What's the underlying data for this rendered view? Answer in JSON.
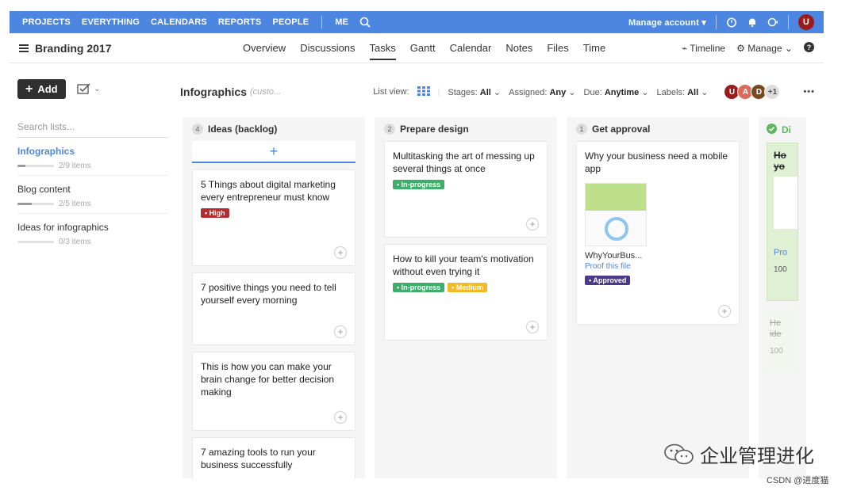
{
  "topnav": {
    "items": [
      "PROJECTS",
      "EVERYTHING",
      "CALENDARS",
      "REPORTS",
      "PEOPLE"
    ],
    "me": "ME",
    "manage_account": "Manage account",
    "user_initial": "U"
  },
  "project": {
    "title": "Branding 2017",
    "tabs": [
      "Overview",
      "Discussions",
      "Tasks",
      "Gantt",
      "Calendar",
      "Notes",
      "Files",
      "Time"
    ],
    "active_tab": "Tasks",
    "timeline": "Timeline",
    "manage": "Manage"
  },
  "sidebar": {
    "add_label": "Add",
    "search_placeholder": "Search lists...",
    "lists": [
      {
        "name": "Infographics",
        "progress": "2/9 items",
        "fraction": 0.22,
        "active": true
      },
      {
        "name": "Blog content",
        "progress": "2/5 items",
        "fraction": 0.4,
        "active": false
      },
      {
        "name": "Ideas for infographics",
        "progress": "0/3 items",
        "fraction": 0,
        "active": false
      }
    ]
  },
  "board": {
    "title": "Infographics",
    "subtitle": "(custo...",
    "list_view": "List view:",
    "stages_label": "Stages:",
    "stages_value": "All",
    "assigned_label": "Assigned:",
    "assigned_value": "Any",
    "due_label": "Due:",
    "due_value": "Anytime",
    "labels_label": "Labels:",
    "labels_value": "All",
    "avatars": [
      "U",
      "A",
      "D"
    ],
    "avatars_more": "+1"
  },
  "columns": [
    {
      "count": "4",
      "name": "Ideas (backlog)",
      "cards": [
        {
          "title": "5 Things about digital marketing every entrepreneur must know",
          "tags": [
            {
              "text": "High",
              "color": "#b32d2e"
            }
          ]
        },
        {
          "title": "7 positive things you need to tell yourself every morning",
          "tags": []
        },
        {
          "title": "This is how you can make your brain change for better decision making",
          "tags": []
        },
        {
          "title": "7 amazing tools to run your business successfully",
          "tags": []
        }
      ]
    },
    {
      "count": "2",
      "name": "Prepare design",
      "cards": [
        {
          "title": "Multitasking the art of messing up several things at once",
          "tags": [
            {
              "text": "In-progress",
              "color": "#3fae6a"
            }
          ]
        },
        {
          "title": "How to kill your team's motivation without even trying it",
          "tags": [
            {
              "text": "In-progress",
              "color": "#3fae6a"
            },
            {
              "text": "Medium",
              "color": "#f2b92b"
            }
          ]
        }
      ]
    },
    {
      "count": "1",
      "name": "Get approval",
      "cards": [
        {
          "title": "Why your business need a mobile app",
          "file": "WhyYourBus...",
          "proof": "Proof this file",
          "tags": [
            {
              "text": "Approved",
              "color": "#4b3a8c"
            }
          ]
        }
      ]
    }
  ],
  "partial_column": {
    "name": "Di",
    "text_a": "Ho",
    "text_b": "yo",
    "link": "Pro",
    "num_a": "100",
    "text_c": "He",
    "text_d": "ide",
    "num_b": "100"
  },
  "watermark": {
    "title": "企业管理进化",
    "credit": "CSDN @进度猫"
  }
}
